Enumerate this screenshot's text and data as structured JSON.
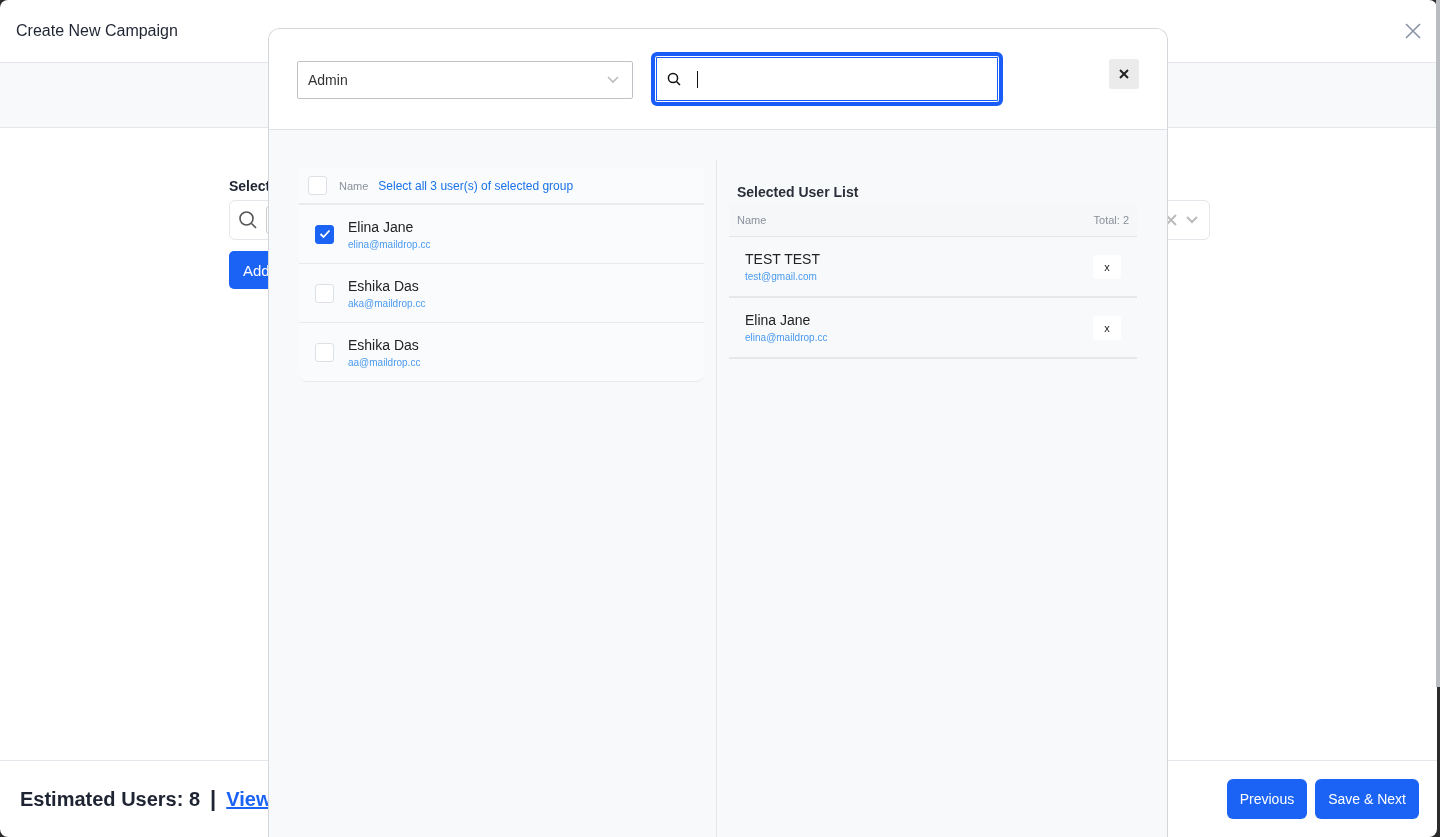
{
  "window": {
    "title": "Create New Campaign"
  },
  "form": {
    "label": "Select",
    "add_button": "Add"
  },
  "footer": {
    "estimate": "Estimated Users: 8",
    "separator": "|",
    "link": "View",
    "buttons": [
      "Previous",
      "Save & Next"
    ]
  },
  "modal": {
    "group_select": {
      "value": "Admin"
    },
    "search": {
      "focused": true
    },
    "user_list": {
      "header": "Name",
      "select_all": "Select all 3 user(s) of selected group",
      "select_all_checked": false,
      "users": [
        {
          "name": "Elina Jane",
          "email": "elina@maildrop.cc",
          "checked": true
        },
        {
          "name": "Eshika Das",
          "email": "aka@maildrop.cc",
          "checked": false
        },
        {
          "name": "Eshika Das",
          "email": "aa@maildrop.cc",
          "checked": false
        }
      ]
    },
    "selected_list": {
      "title": "Selected User List",
      "header": "Name",
      "total": "Total: 2",
      "users": [
        {
          "name": "TEST TEST",
          "email": "test@gmail.com",
          "remove": "x"
        },
        {
          "name": "Elina Jane",
          "email": "elina@maildrop.cc",
          "remove": "x"
        }
      ]
    }
  }
}
